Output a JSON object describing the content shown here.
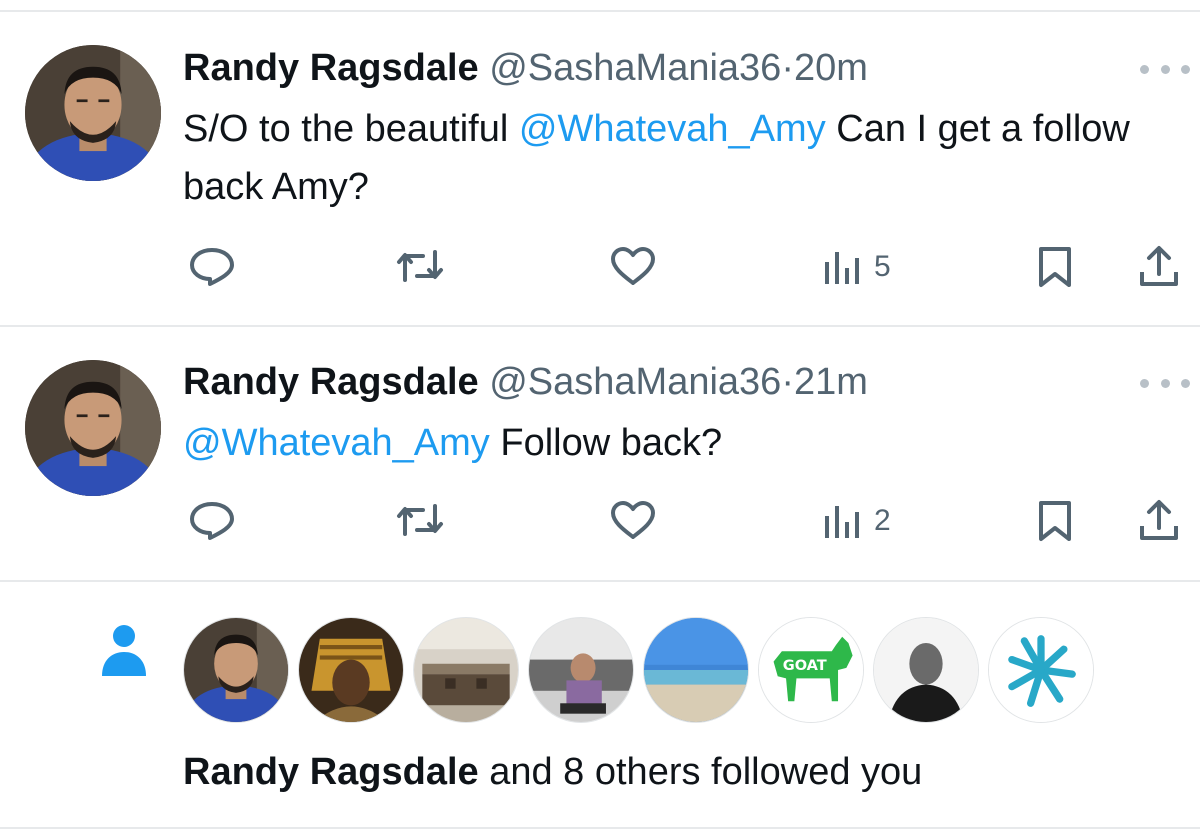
{
  "tweets": [
    {
      "name": "Randy Ragsdale",
      "handle": "@SashaMania36",
      "dot": "·",
      "time": "20m",
      "mention": "@Whatevah_Amy",
      "text_before": "S/O to the beautiful ",
      "text_after": " Can I get a follow back Amy?",
      "views": "5"
    },
    {
      "name": "Randy Ragsdale",
      "handle": "@SashaMania36",
      "dot": "·",
      "time": "21m",
      "mention": "@Whatevah_Amy",
      "text_before": "",
      "text_after": " Follow back?",
      "views": "2"
    }
  ],
  "notification": {
    "icon": "person-icon",
    "name": "Randy Ragsdale",
    "rest": " and 8 others followed you",
    "avatars": [
      "randy",
      "pharaoh",
      "kitchen",
      "gym",
      "beach",
      "goat",
      "man-bw",
      "starburst"
    ],
    "goat_text": "GOAT"
  },
  "colors": {
    "accent": "#1d9bf0",
    "text": "#0f1419",
    "secondary": "#536471",
    "divider": "#e7e9eb"
  }
}
